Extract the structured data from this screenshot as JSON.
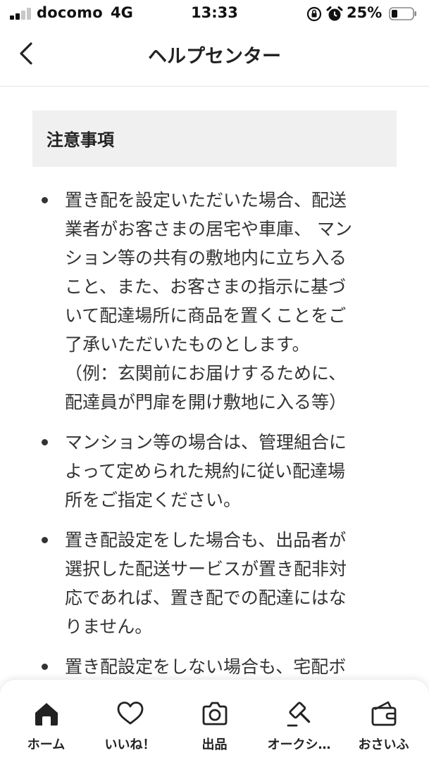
{
  "status_bar": {
    "carrier": "docomo",
    "network": "4G",
    "time": "13:33",
    "battery_percent": "25%"
  },
  "header": {
    "title": "ヘルプセンター"
  },
  "section": {
    "heading": "注意事項",
    "items": [
      {
        "lines": [
          "置き配を設定いただいた場合、配送",
          "業者がお客さまの居宅や車庫、 マン",
          "ション等の共有の敷地内に立ち入る",
          "こと、また、お客さまの指示に基づ",
          "いて配達場所に商品を置くことをご",
          "了承いただいたものとします。",
          "（例：玄関前にお届けするために、",
          "配達員が門扉を開け敷地に入る等）"
        ]
      },
      {
        "lines": [
          "マンション等の場合は、管理組合に",
          "よって定められた規約に従い配達場",
          "所をご指定ください。"
        ]
      },
      {
        "lines": [
          "置き配設定をした場合も、出品者が",
          "選択した配送サービスが置き配非対",
          "応であれば、置き配での配達にはな",
          "りません。"
        ]
      },
      {
        "lines": [
          "置き配設定をしない場合も、宅配ボ"
        ]
      }
    ]
  },
  "tab_bar": {
    "tabs": [
      {
        "label": "ホーム",
        "icon": "home-icon"
      },
      {
        "label": "いいね！",
        "icon": "heart-icon"
      },
      {
        "label": "出品",
        "icon": "camera-icon"
      },
      {
        "label": "オークシ…",
        "icon": "auction-hammer-icon"
      },
      {
        "label": "おさいふ",
        "icon": "wallet-icon"
      }
    ]
  }
}
